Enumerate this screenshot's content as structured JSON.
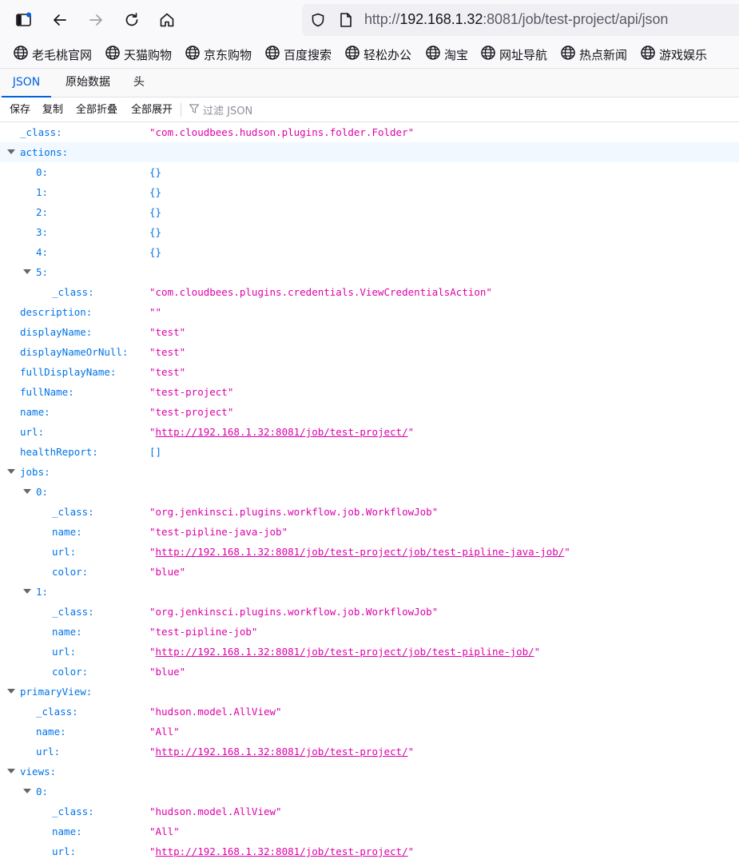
{
  "browser": {
    "url_prefix": "http://",
    "url_host": "192.168.1.32",
    "url_rest": ":8081/job/test-project/api/json"
  },
  "bookmarks": [
    {
      "label": "老毛桃官网",
      "icon": "globe-icon"
    },
    {
      "label": "天猫购物",
      "icon": "globe-icon"
    },
    {
      "label": "京东购物",
      "icon": "globe-icon"
    },
    {
      "label": "百度搜索",
      "icon": "globe-icon"
    },
    {
      "label": "轻松办公",
      "icon": "globe-icon"
    },
    {
      "label": "淘宝",
      "icon": "globe-icon"
    },
    {
      "label": "网址导航",
      "icon": "globe-icon"
    },
    {
      "label": "热点新闻",
      "icon": "globe-icon"
    },
    {
      "label": "游戏娱乐",
      "icon": "globe-icon"
    }
  ],
  "viewer": {
    "tabs": [
      "JSON",
      "原始数据",
      "头"
    ],
    "active_tab": "JSON",
    "actions": [
      "保存",
      "复制",
      "全部折叠",
      "全部展开"
    ],
    "filter_placeholder": "过滤 JSON",
    "accent": "#0060df"
  },
  "colors": {
    "key": "#0074e8",
    "string": "#dd00a9",
    "highlight_row": "#f1f8ff"
  },
  "json_rows": [
    {
      "key": "_class:",
      "value": "\"com.cloudbees.hudson.plugins.folder.Folder\"",
      "type": "str"
    },
    {
      "key": "actions:",
      "value": "",
      "type": "none",
      "expanded": true,
      "highlight": true
    },
    {
      "key": "0:",
      "value": "{}",
      "type": "obj"
    },
    {
      "key": "1:",
      "value": "{}",
      "type": "obj"
    },
    {
      "key": "2:",
      "value": "{}",
      "type": "obj"
    },
    {
      "key": "3:",
      "value": "{}",
      "type": "obj"
    },
    {
      "key": "4:",
      "value": "{}",
      "type": "obj"
    },
    {
      "key": "5:",
      "value": "",
      "type": "none",
      "expanded": true
    },
    {
      "key": "_class:",
      "value": "\"com.cloudbees.plugins.credentials.ViewCredentialsAction\"",
      "type": "str"
    },
    {
      "key": "description:",
      "value": "\"\"",
      "type": "str"
    },
    {
      "key": "displayName:",
      "value": "\"test\"",
      "type": "str"
    },
    {
      "key": "displayNameOrNull:",
      "value": "\"test\"",
      "type": "str"
    },
    {
      "key": "fullDisplayName:",
      "value": "\"test\"",
      "type": "str"
    },
    {
      "key": "fullName:",
      "value": "\"test-project\"",
      "type": "str"
    },
    {
      "key": "name:",
      "value": "\"test-project\"",
      "type": "str"
    },
    {
      "key": "url:",
      "value": "http://192.168.1.32:8081/job/test-project/",
      "type": "link"
    },
    {
      "key": "healthReport:",
      "value": "[]",
      "type": "obj"
    },
    {
      "key": "jobs:",
      "value": "",
      "type": "none",
      "expanded": true
    },
    {
      "key": "0:",
      "value": "",
      "type": "none",
      "expanded": true
    },
    {
      "key": "_class:",
      "value": "\"org.jenkinsci.plugins.workflow.job.WorkflowJob\"",
      "type": "str"
    },
    {
      "key": "name:",
      "value": "\"test-pipline-java-job\"",
      "type": "str"
    },
    {
      "key": "url:",
      "value": "http://192.168.1.32:8081/job/test-project/job/test-pipline-java-job/",
      "type": "link"
    },
    {
      "key": "color:",
      "value": "\"blue\"",
      "type": "str"
    },
    {
      "key": "1:",
      "value": "",
      "type": "none",
      "expanded": true
    },
    {
      "key": "_class:",
      "value": "\"org.jenkinsci.plugins.workflow.job.WorkflowJob\"",
      "type": "str"
    },
    {
      "key": "name:",
      "value": "\"test-pipline-job\"",
      "type": "str"
    },
    {
      "key": "url:",
      "value": "http://192.168.1.32:8081/job/test-project/job/test-pipline-job/",
      "type": "link"
    },
    {
      "key": "color:",
      "value": "\"blue\"",
      "type": "str"
    },
    {
      "key": "primaryView:",
      "value": "",
      "type": "none",
      "expanded": true
    },
    {
      "key": "_class:",
      "value": "\"hudson.model.AllView\"",
      "type": "str"
    },
    {
      "key": "name:",
      "value": "\"All\"",
      "type": "str"
    },
    {
      "key": "url:",
      "value": "http://192.168.1.32:8081/job/test-project/",
      "type": "link"
    },
    {
      "key": "views:",
      "value": "",
      "type": "none",
      "expanded": true
    },
    {
      "key": "0:",
      "value": "",
      "type": "none",
      "expanded": true
    },
    {
      "key": "_class:",
      "value": "\"hudson.model.AllView\"",
      "type": "str"
    },
    {
      "key": "name:",
      "value": "\"All\"",
      "type": "str"
    },
    {
      "key": "url:",
      "value": "http://192.168.1.32:8081/job/test-project/",
      "type": "link"
    }
  ]
}
